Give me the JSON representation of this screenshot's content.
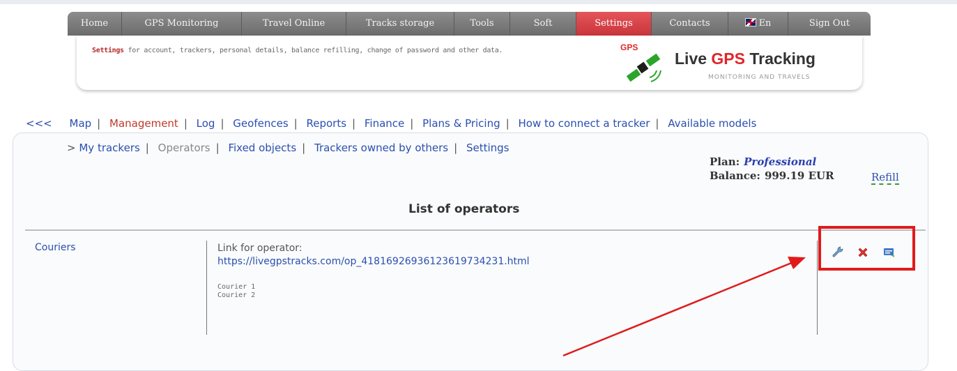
{
  "topnav": {
    "tabs": [
      {
        "label": "Home"
      },
      {
        "label": "GPS Monitoring"
      },
      {
        "label": "Travel Online"
      },
      {
        "label": "Tracks storage"
      },
      {
        "label": "Tools"
      },
      {
        "label": "Soft"
      },
      {
        "label": "Settings",
        "active": true
      },
      {
        "label": "Contacts"
      },
      {
        "label": "En",
        "icon": "uk-flag-icon"
      },
      {
        "label": "Sign Out"
      }
    ]
  },
  "banner": {
    "settings_word": "Settings",
    "description": " for account, trackers, personal details, balance refilling, change of password and other data.",
    "logo": {
      "gps_badge": "GPS",
      "title_prefix": "Live ",
      "title_highlight": "GPS",
      "title_suffix": " Tracking",
      "subtitle": "MONITORING AND TRAVELS"
    }
  },
  "mainnav": {
    "back": "<<<",
    "items": [
      "Map",
      "Management",
      "Log",
      "Geofences",
      "Reports",
      "Finance",
      "Plans & Pricing",
      "How to connect a tracker",
      "Available models"
    ],
    "current": "Management"
  },
  "subnav": {
    "prefix": ">",
    "items": [
      "My trackers",
      "Operators",
      "Fixed objects",
      "Trackers owned by others",
      "Settings"
    ],
    "current": "Operators"
  },
  "account": {
    "plan_label": "Plan:",
    "plan_value": "Professional",
    "balance_label": "Balance:",
    "balance_value": "999.19 EUR",
    "refill": "Refill"
  },
  "list": {
    "title": "List of operators",
    "operator": {
      "name": "Couriers",
      "link_label": "Link for operator:",
      "link_url": "https://livegpstracks.com/op_418169269361236197342​31.html",
      "couriers": [
        "Courier 1",
        "Courier 2"
      ]
    },
    "actions": [
      {
        "icon": "wrench-icon"
      },
      {
        "icon": "delete-x-icon"
      },
      {
        "icon": "message-icon"
      }
    ]
  },
  "colors": {
    "active_tab": "#d63a40",
    "highlight_box": "#e01b1b",
    "link": "#2a4fb0"
  }
}
